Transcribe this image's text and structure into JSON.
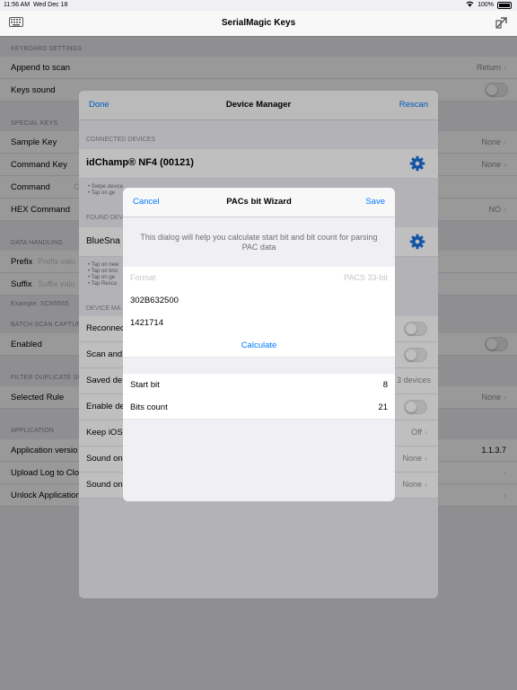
{
  "status": {
    "time": "11:56 AM",
    "date": "Wed Dec 18",
    "battery": "100%"
  },
  "app": {
    "title": "SerialMagic Keys"
  },
  "bg": {
    "keyboard_settings": "KEYBOARD SETTINGS",
    "append_to_scan": "Append to scan",
    "append_value": "Return",
    "keys_sound": "Keys sound",
    "special_keys": "SPECIAL KEYS",
    "sample_key": "Sample Key",
    "sample_value": "None",
    "command_key": "Command Key",
    "command_key_value": "None",
    "command": "Command",
    "command_ph": "C",
    "hex_command": "HEX Command",
    "hex_value": "NO",
    "data_handling": "DATA HANDLING",
    "prefix": "Prefix",
    "prefix_ph": "Prefix valu",
    "suffix": "Suffix",
    "suffix_ph": "Suffix valu",
    "example": "Example: SCN5555",
    "batch_scan": "BATCH SCAN CAPTUR",
    "enabled": "Enabled",
    "filter_dup": "FILTER DUPLICATE SC",
    "selected_rule": "Selected Rule",
    "selected_rule_value": "None",
    "application": "APPLICATION",
    "app_version": "Application versio",
    "app_version_value": "1.1.3.7",
    "upload_log": "Upload Log to Clo",
    "unlock_app": "Unlock Application"
  },
  "dm": {
    "done": "Done",
    "title": "Device Manager",
    "rescan": "Rescan",
    "connected_devices": "CONNECTED DEVICES",
    "device_name": "idChamp® NF4 (00121)",
    "swipe_hint": "• Swipe device",
    "tap_hint": "• Tap on ge",
    "found_devices": "FOUND DEV",
    "found_name": "BlueSna",
    "found_hint_1": "• Tap on new",
    "found_hint_2": "• Tap on kno",
    "found_hint_3": "• Tap on ge",
    "found_hint_4": "• Tap Resca",
    "device_manager_sec": "DEVICE MA",
    "reconnect": "Reconnec",
    "scan_and": "Scan and",
    "saved_devices": "Saved de",
    "saved_value": "3 devices",
    "enable_de": "Enable de",
    "keep_ios": "Keep iOS",
    "keep_value": "Off",
    "sound_on_1": "Sound on",
    "sound_on_1_value": "None",
    "sound_on_2": "Sound on",
    "sound_on_2_value": "None"
  },
  "wizard": {
    "cancel": "Cancel",
    "title": "PACs bit Wizard",
    "save": "Save",
    "description": "This dialog will help you calculate start bit and bit count for parsing PAC data",
    "format_label": "Format",
    "format_value": "PACS 33-bit",
    "hex_value": "302B632500",
    "dec_value": "1421714",
    "calculate": "Calculate",
    "start_bit_label": "Start bit",
    "start_bit_value": "8",
    "bits_count_label": "Bits count",
    "bits_count_value": "21"
  },
  "colors": {
    "accent": "#007aff",
    "background": "#efeff4"
  }
}
